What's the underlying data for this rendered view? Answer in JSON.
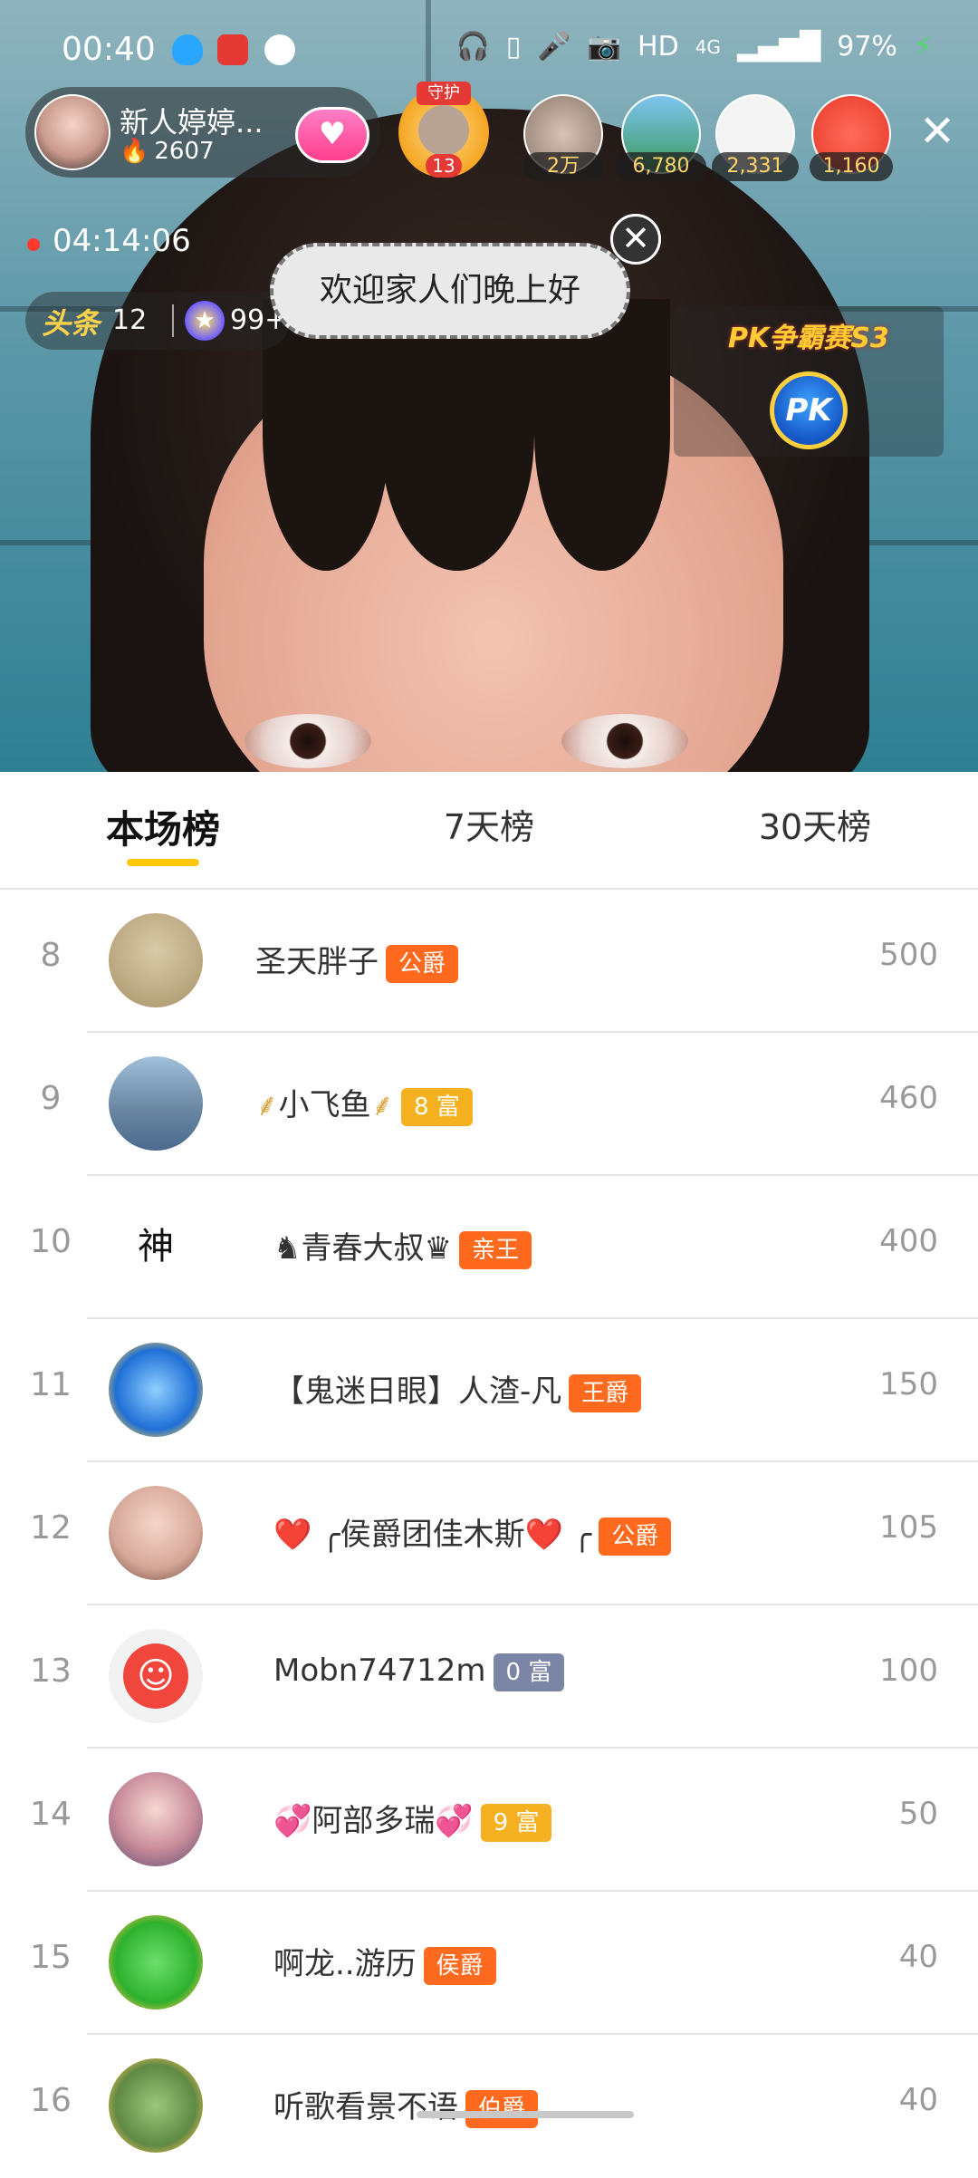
{
  "status_bar": {
    "time": "00:40",
    "network": "HD",
    "signal": "4G",
    "battery": "97%"
  },
  "anchor": {
    "name": "新人婷婷...",
    "popularity": "2607"
  },
  "guard": {
    "tag": "守护",
    "level": "13"
  },
  "audience": [
    {
      "count": "2万"
    },
    {
      "count": "6,780"
    },
    {
      "count": "2,331"
    },
    {
      "count": "1,160"
    }
  ],
  "live": {
    "elapsed": "04:14:06"
  },
  "headline": {
    "label": "头条",
    "count": "12",
    "star_count": "99+"
  },
  "welcome": "欢迎家人们晚上好",
  "pk": {
    "title": "PK争霸赛S3",
    "button": "PK"
  },
  "tabs": [
    {
      "label": "本场榜"
    },
    {
      "label": "7天榜"
    },
    {
      "label": "30天榜"
    }
  ],
  "rankings": [
    {
      "rank": "8",
      "name": "圣天胖子",
      "badge": "公爵",
      "score": "500"
    },
    {
      "rank": "9",
      "name": "小飞鱼",
      "badge": "8 富",
      "score": "460"
    },
    {
      "rank": "10",
      "name": "♞青春大叔♛",
      "badge": "亲王",
      "score": "400"
    },
    {
      "rank": "11",
      "name": "【鬼迷日眼】人渣-凡",
      "badge": "王爵",
      "score": "150"
    },
    {
      "rank": "12",
      "name": "❤️ ╭侯爵团佳木斯❤️ ╭",
      "badge": "公爵",
      "score": "105"
    },
    {
      "rank": "13",
      "name": "Mobn74712m",
      "badge": "0 富",
      "score": "100"
    },
    {
      "rank": "14",
      "name": "💞阿部多瑞💞",
      "badge": "9 富",
      "score": "50"
    },
    {
      "rank": "15",
      "name": "啊龙..游历",
      "badge": "侯爵",
      "score": "40"
    },
    {
      "rank": "16",
      "name": "听歌看景不语",
      "badge": "伯爵",
      "score": "40"
    }
  ],
  "avatar_text": {
    "row10": "神"
  },
  "colors": {
    "accent": "#ffc60b",
    "badge_noble": "#ff6a1e",
    "badge_rich": "#f5b120",
    "badge_rich_zero": "#7b86a6"
  },
  "icons": {
    "close": "close-icon",
    "flame": "flame-icon",
    "pk": "pk-icon"
  }
}
